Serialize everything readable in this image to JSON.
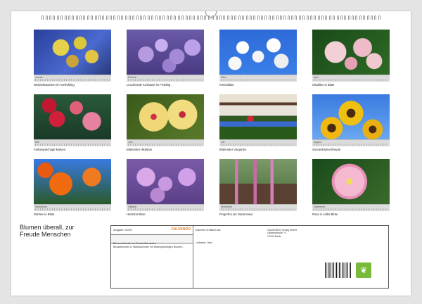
{
  "tiles": [
    {
      "month": "Januar",
      "caption": "Weidenkätzchen im Vorfrühling"
    },
    {
      "month": "Februar",
      "caption": "Leuchtende Krokusse im Frühling"
    },
    {
      "month": "März",
      "caption": "Kirschblüte"
    },
    {
      "month": "April",
      "caption": "Inkalilien in Blüte"
    },
    {
      "month": "Mai",
      "caption": "Farbenprächtige Malven"
    },
    {
      "month": "Juni",
      "caption": "Blühender Hibiskus"
    },
    {
      "month": "Juli",
      "caption": "Blühender Vorgarten"
    },
    {
      "month": "August",
      "caption": "Sonnenblumenfreude"
    },
    {
      "month": "September",
      "caption": "Dahlien in Blüte"
    },
    {
      "month": "Oktober",
      "caption": "Herbstzeitlose"
    },
    {
      "month": "November",
      "caption": "Fingerhut am Gartenzaun"
    },
    {
      "month": "Dezember",
      "caption": "Rose in voller Blüte"
    }
  ],
  "title_line1": "Blumen überall, zur",
  "title_line2": "Freude Menschen",
  "info": {
    "row1_left": "Ausgabe: 2023/2",
    "logo": "CALVENDO",
    "row2": "Blumen überall, zur Freude Menschen",
    "description": "Bezauberndes in Wandkalender mit farbenprächtigen Blumen...",
    "col2_line1": "Kalender erhältlich als:",
    "col2_line2": "Lieferbar: Jetzt",
    "col3_line1": "CALVENDO Verlag GmbH",
    "col3_line2": "Ullsteinstraße 73",
    "col3_line3": "12109 Berlin"
  }
}
